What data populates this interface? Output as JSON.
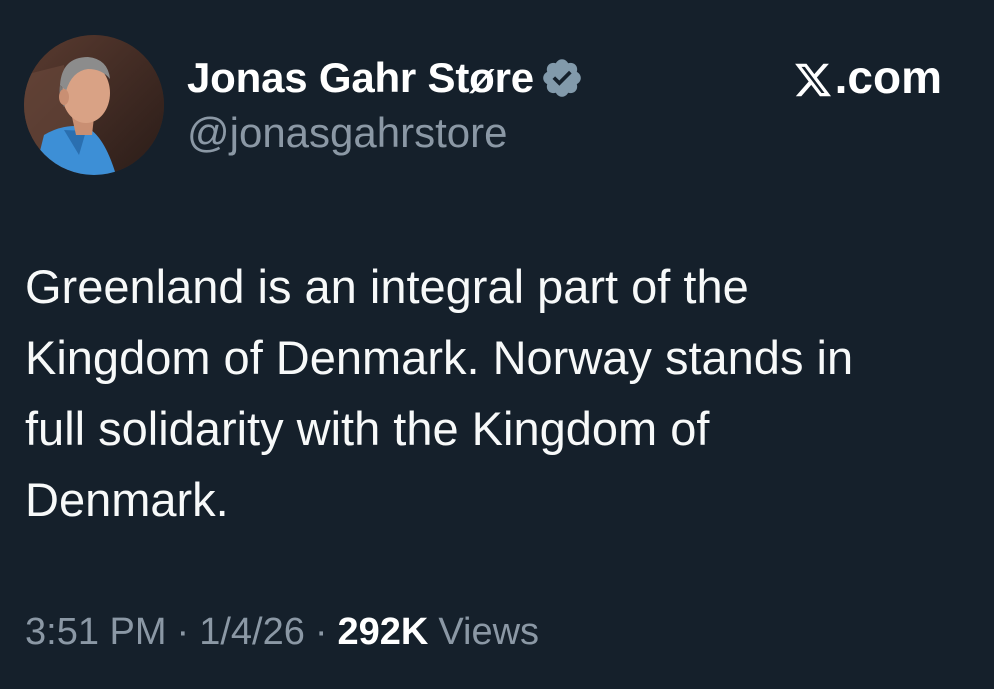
{
  "tweet": {
    "author": {
      "display_name": "Jonas Gahr Støre",
      "handle": "@jonasgahrstore",
      "verified": true,
      "avatar_icon": "profile-photo"
    },
    "site_label": ".com",
    "site_icon": "x-logo-icon",
    "text": "Greenland is an integral part of the\nKingdom of Denmark. Norway stands in\nfull solidarity with the Kingdom of\nDenmark.",
    "time": "3:51 PM",
    "date": "1/4/26",
    "separator": "·",
    "views_count": "292K",
    "views_label": "Views"
  },
  "colors": {
    "background": "#15202b",
    "primary_text": "#ffffff",
    "secondary_text": "#8b98a5",
    "verified_badge": "#829aab"
  }
}
